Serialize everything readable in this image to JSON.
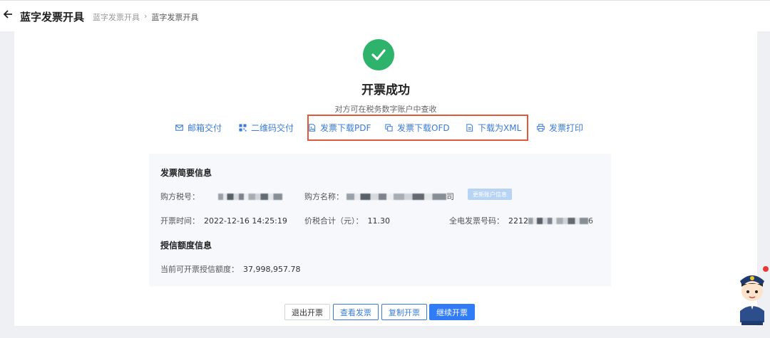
{
  "header": {
    "title": "蓝字发票开具",
    "breadcrumb": [
      "蓝字发票开具",
      "蓝字发票开具"
    ],
    "breadcrumb_sep": "›"
  },
  "result": {
    "title": "开票成功",
    "subtitle": "对方可在税务数字账户中查收"
  },
  "actions": {
    "email": "邮箱交付",
    "qrcode": "二维码交付",
    "pdf": "发票下载PDF",
    "ofd": "发票下载OFD",
    "xml": "下载为XML",
    "print": "发票打印"
  },
  "summary": {
    "title": "发票简要信息",
    "buyer_tax_label": "购方税号：",
    "buyer_name_label": "购方名称：",
    "buyer_name_suffix": "司",
    "update_label": "更新账户信息",
    "issue_time_label": "开票时间：",
    "issue_time_value": "2022-12-16 14:25:19",
    "total_label": "价税合计（元）：",
    "total_value": "11.30",
    "invoice_no_label": "全电发票号码：",
    "invoice_no_prefix": "2212",
    "invoice_no_suffix": "6"
  },
  "credit": {
    "title": "授信额度信息",
    "label": "当前可开票授信额度：",
    "value": "37,998,957.78"
  },
  "buttons": {
    "exit": "退出开票",
    "view": "查看发票",
    "copy": "复制开票",
    "continue": "继续开票"
  },
  "colors": {
    "accent": "#3a7bd5",
    "success": "#2db36b",
    "primary": "#2f7cf6",
    "highlight": "#e05a3a"
  }
}
